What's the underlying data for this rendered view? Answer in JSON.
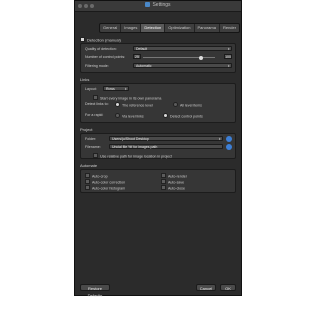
{
  "window": {
    "title": "Settings"
  },
  "tabs": [
    "General",
    "Images",
    "Detection",
    "Optimization",
    "Panorama",
    "Render"
  ],
  "detection": {
    "header": "Detection (manual)",
    "quality_label": "Quality of detection:",
    "quality_value": "Default",
    "ctrl_points_label": "Number of control points:",
    "ctrl_points_left": "25",
    "ctrl_points_right": "100",
    "filtering_label": "Filtering mode:",
    "filtering_value": "Automatic"
  },
  "links": {
    "header": "Links",
    "layout_label": "Layout:",
    "layout_value": "Rows",
    "check1": "Start every image in its own panorama",
    "detect_label": "Detect links to:",
    "radio1": "The reference level",
    "radio2": "All level items",
    "for_rapid_label": "For a rapid:",
    "radio3": "Via level links",
    "radio4": "Detect control points"
  },
  "project": {
    "header": "Project",
    "folder_label": "Folder:",
    "folder_value": "Users/ju/Shoot Desktop",
    "filename_label": "Filename:",
    "filename_value": "Uncial file %f for images path",
    "check": "Use relative path for image location in project"
  },
  "automate": {
    "header": "Automate",
    "items": [
      "Auto-crop",
      "Auto-color correction",
      "Auto-color histogram",
      "Auto-render",
      "Auto-save",
      "Auto-close"
    ]
  },
  "footer": {
    "restore": "Restore Defaults",
    "cancel": "Cancel",
    "ok": "OK"
  }
}
